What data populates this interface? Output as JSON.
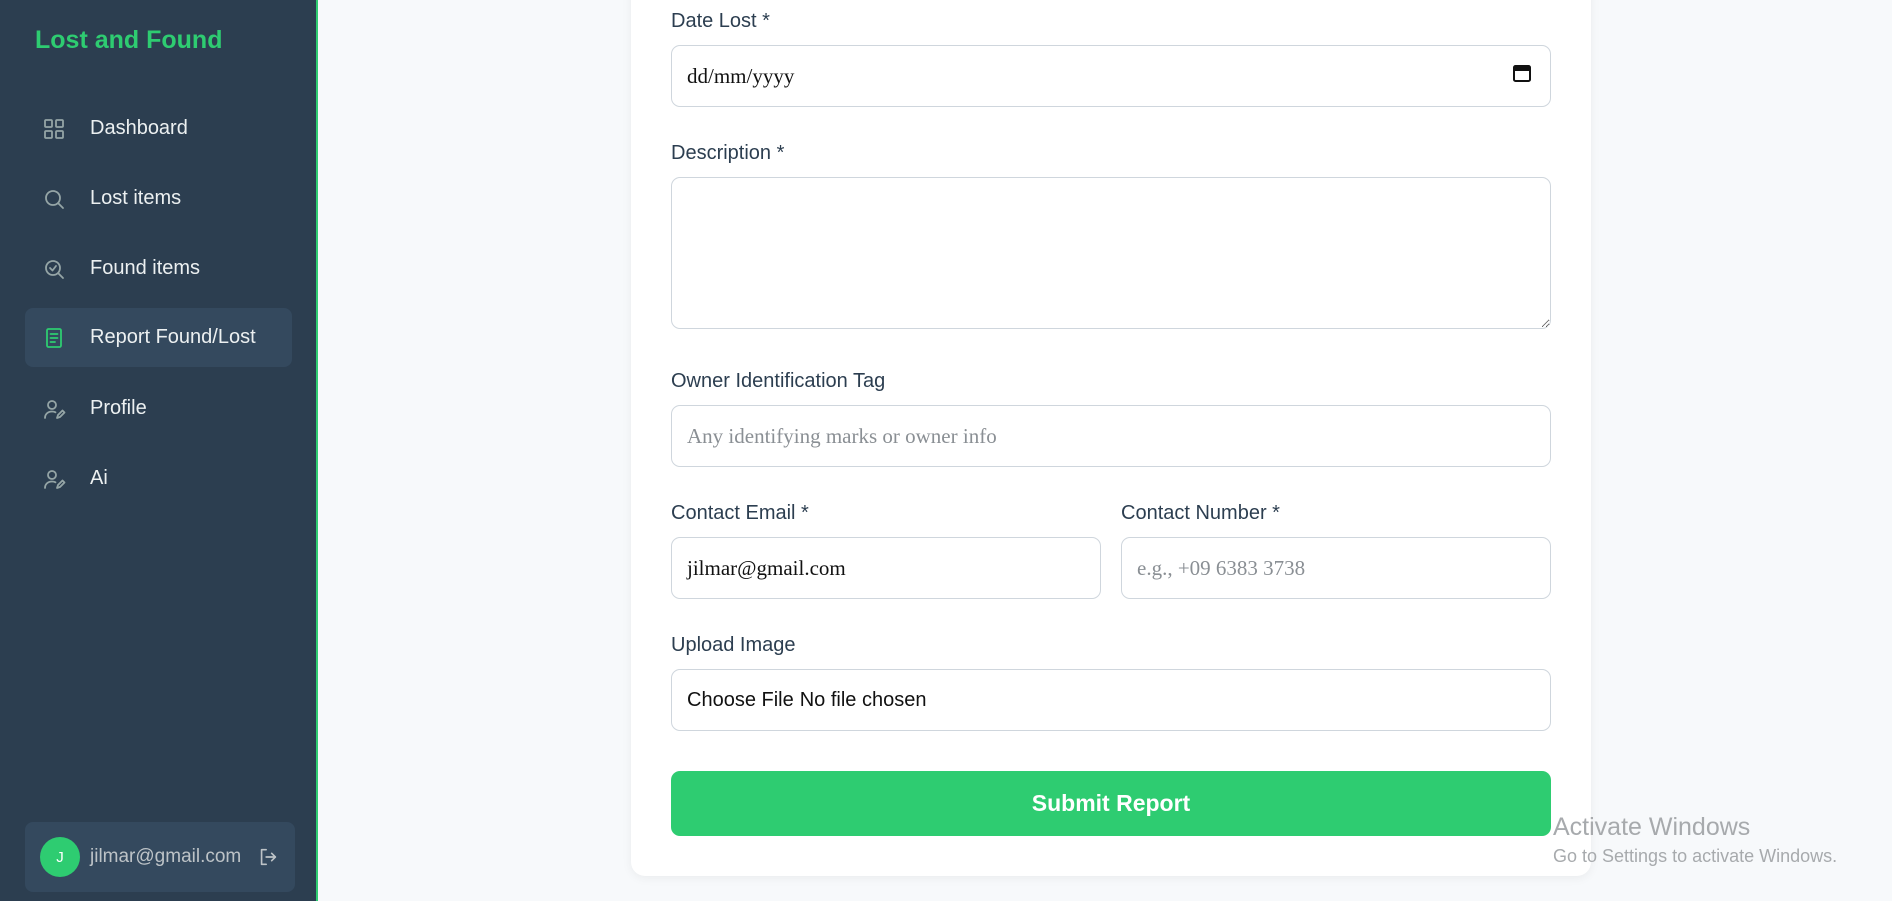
{
  "app": {
    "brand": "Lost and Found"
  },
  "sidebar": {
    "items": [
      {
        "label": "Dashboard",
        "icon": "grid-icon"
      },
      {
        "label": "Lost items",
        "icon": "search-icon"
      },
      {
        "label": "Found items",
        "icon": "search-check-icon"
      },
      {
        "label": "Report Found/Lost",
        "icon": "report-icon",
        "active": true
      },
      {
        "label": "Profile",
        "icon": "user-edit-icon"
      },
      {
        "label": "Ai",
        "icon": "user-edit-icon"
      }
    ],
    "user": {
      "initial": "J",
      "email": "jilmar@gmail.com"
    }
  },
  "form": {
    "date_lost": {
      "label": "Date Lost *",
      "value": "dd/mm/yyyy"
    },
    "description": {
      "label": "Description *",
      "value": ""
    },
    "owner_tag": {
      "label": "Owner Identification Tag",
      "placeholder": "Any identifying marks or owner info"
    },
    "contact_email": {
      "label": "Contact Email *",
      "value": "jilmar@gmail.com"
    },
    "contact_number": {
      "label": "Contact Number *",
      "placeholder": "e.g., +09 6383 3738"
    },
    "upload_image": {
      "label": "Upload Image",
      "button": "Choose File",
      "status": "No file chosen"
    },
    "submit_label": "Submit Report"
  },
  "watermark": {
    "title": "Activate Windows",
    "subtitle": "Go to Settings to activate Windows."
  },
  "colors": {
    "sidebar_bg": "#2c3e50",
    "accent": "#2ecc71",
    "active_item_bg": "#34495e",
    "page_bg": "#f7f9fb"
  }
}
